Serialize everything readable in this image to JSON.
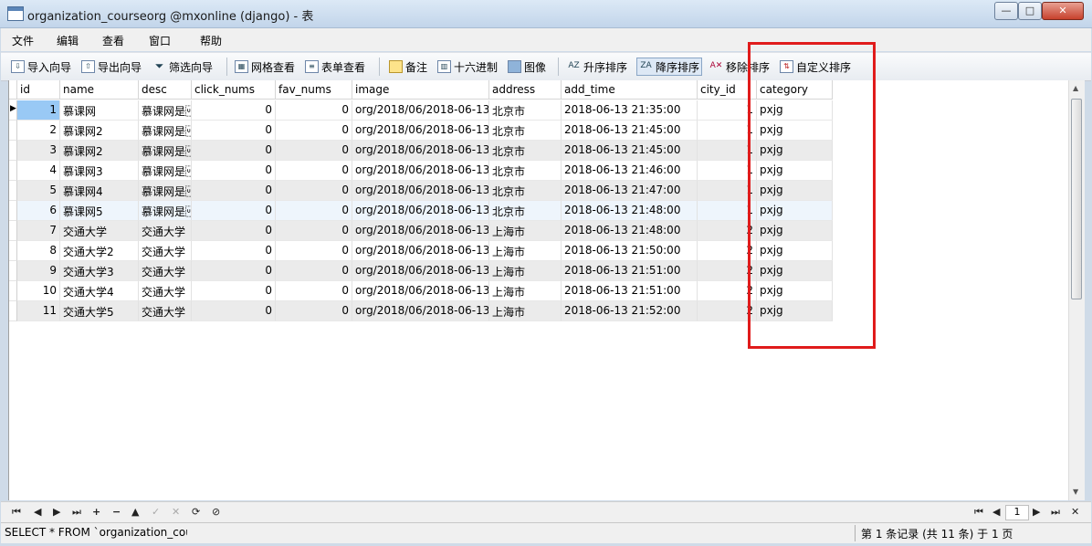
{
  "window": {
    "title": "organization_courseorg @mxonline (django) - 表",
    "min": "—",
    "max": "□",
    "close": "✕"
  },
  "menu": [
    "文件",
    "编辑",
    "查看",
    "窗口",
    "帮助"
  ],
  "toolbar": {
    "import": "导入向导",
    "export": "导出向导",
    "filter": "筛选向导",
    "grid_view": "网格查看",
    "form_view": "表单查看",
    "memo": "备注",
    "hex": "十六进制",
    "image": "图像",
    "sort_asc": "升序排序",
    "sort_desc": "降序排序",
    "remove_sort": "移除排序",
    "custom_sort": "自定义排序"
  },
  "columns": [
    "id",
    "name",
    "desc",
    "click_nums",
    "fav_nums",
    "image",
    "address",
    "add_time",
    "city_id",
    "category"
  ],
  "rows": [
    [
      "1",
      "慕课网",
      "慕课网是\u001f",
      "0",
      "0",
      "org/2018/06/2018-06-13_",
      "北京市",
      "2018-06-13 21:35:00",
      "1",
      "pxjg"
    ],
    [
      "2",
      "慕课网2",
      "慕课网是\u001f",
      "0",
      "0",
      "org/2018/06/2018-06-13_",
      "北京市",
      "2018-06-13 21:45:00",
      "1",
      "pxjg"
    ],
    [
      "3",
      "慕课网2",
      "慕课网是\u001f",
      "0",
      "0",
      "org/2018/06/2018-06-13_",
      "北京市",
      "2018-06-13 21:45:00",
      "1",
      "pxjg"
    ],
    [
      "4",
      "慕课网3",
      "慕课网是\u001f",
      "0",
      "0",
      "org/2018/06/2018-06-13_",
      "北京市",
      "2018-06-13 21:46:00",
      "1",
      "pxjg"
    ],
    [
      "5",
      "慕课网4",
      "慕课网是\u001f",
      "0",
      "0",
      "org/2018/06/2018-06-13_",
      "北京市",
      "2018-06-13 21:47:00",
      "1",
      "pxjg"
    ],
    [
      "6",
      "慕课网5",
      "慕课网是\u001f",
      "0",
      "0",
      "org/2018/06/2018-06-13_",
      "北京市",
      "2018-06-13 21:48:00",
      "1",
      "pxjg"
    ],
    [
      "7",
      "交通大学",
      "交通大学",
      "0",
      "0",
      "org/2018/06/2018-06-13_",
      "上海市",
      "2018-06-13 21:48:00",
      "2",
      "pxjg"
    ],
    [
      "8",
      "交通大学2",
      "交通大学",
      "0",
      "0",
      "org/2018/06/2018-06-13_",
      "上海市",
      "2018-06-13 21:50:00",
      "2",
      "pxjg"
    ],
    [
      "9",
      "交通大学3",
      "交通大学",
      "0",
      "0",
      "org/2018/06/2018-06-13_",
      "上海市",
      "2018-06-13 21:51:00",
      "2",
      "pxjg"
    ],
    [
      "10",
      "交通大学4",
      "交通大学",
      "0",
      "0",
      "org/2018/06/2018-06-13_",
      "上海市",
      "2018-06-13 21:51:00",
      "2",
      "pxjg"
    ],
    [
      "11",
      "交通大学5",
      "交通大学",
      "0",
      "0",
      "org/2018/06/2018-06-13_",
      "上海市",
      "2018-06-13 21:52:00",
      "2",
      "pxjg"
    ]
  ],
  "nav": {
    "first": "⏮",
    "prev": "◀",
    "next": "▶",
    "last": "⏭",
    "add": "+",
    "delete": "−",
    "apply": "▲",
    "commit": "✓",
    "cancel": "✕",
    "refresh": "⟳",
    "stop": "⊘",
    "page": "1"
  },
  "status": {
    "sql": "SELECT * FROM `organization_cou",
    "records": "第 1 条记录 (共 11 条) 于 1 页"
  }
}
